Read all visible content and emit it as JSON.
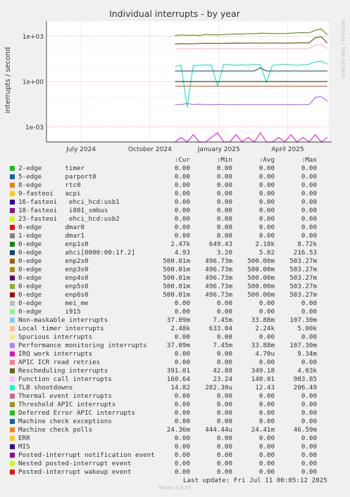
{
  "chart_data": {
    "type": "line",
    "title": "Individual interrupts - by year",
    "ylabel": "interrupts / second",
    "xlabel": "",
    "y_scale": "log",
    "ylim": [
      0.0001,
      10000
    ],
    "y_ticks": [
      "1e+03",
      "1e+00",
      "1e-03"
    ],
    "x_ticks": [
      "July 2024",
      "October 2024",
      "January 2025",
      "April 2025"
    ],
    "side_label": "RRDTOOL / TOBI OETIKER",
    "grid": true,
    "series_levels": [
      {
        "color": "#4d7f00",
        "values": [
          1100,
          1200,
          1150,
          1180,
          1100,
          1300,
          1250,
          1200,
          1300,
          1350,
          1400,
          1380,
          1500,
          1450,
          1600,
          1550,
          1500,
          1480,
          1520,
          1600,
          1650,
          1700,
          1650,
          2500,
          3000,
          1200
        ]
      },
      {
        "color": "#553300",
        "values": [
          300,
          320,
          310,
          315,
          330,
          340,
          335,
          330,
          340,
          345,
          350,
          348,
          352,
          355,
          350,
          353,
          356,
          352,
          350,
          355,
          360,
          365,
          362,
          800,
          900,
          350
        ]
      },
      {
        "color": "#ffb0d0",
        "values": [
          140,
          150,
          145,
          150,
          148,
          152,
          150,
          149,
          151,
          153,
          150,
          152,
          150,
          151,
          150,
          152,
          149,
          150,
          151,
          150,
          152,
          150,
          151,
          260,
          280,
          150
        ]
      },
      {
        "color": "#00e0c0",
        "values": [
          10,
          12,
          0.02,
          11,
          12,
          13,
          12,
          0.5,
          14,
          13,
          12,
          13,
          12,
          14,
          13,
          0.9,
          12,
          13,
          14,
          13,
          12,
          13,
          14,
          20,
          22,
          14
        ]
      },
      {
        "color": "#0f3f6f",
        "values": [
          5,
          5,
          5,
          5,
          5,
          5,
          5,
          5,
          5,
          5,
          5,
          5,
          5,
          5,
          8,
          5,
          5,
          5,
          5,
          5,
          5,
          5,
          5,
          5,
          5,
          5
        ]
      },
      {
        "color": "#111111",
        "values": [
          1,
          1,
          1,
          1,
          1,
          1,
          1,
          1,
          1,
          1,
          1,
          1,
          1,
          1,
          1,
          1,
          1,
          1,
          1,
          1,
          1,
          1,
          1,
          1,
          1,
          1
        ]
      },
      {
        "color": "#e05000",
        "values": [
          0.5,
          0.5,
          0.5,
          0.5,
          0.5,
          0.5,
          0.5,
          0.5,
          0.5,
          0.5,
          0.5,
          0.5,
          0.5,
          0.5,
          0.5,
          0.5,
          0.5,
          0.5,
          0.5,
          0.5,
          0.5,
          0.5,
          0.5,
          0.5,
          0.5,
          0.5
        ]
      },
      {
        "color": "#9b59ff",
        "values": [
          0.03,
          0.03,
          0.035,
          0.03,
          0.032,
          0.03,
          0.03,
          0.031,
          0.03,
          0.03,
          0.03,
          0.03,
          0.03,
          0.03,
          0.03,
          0.03,
          0.03,
          0.03,
          0.03,
          0.03,
          0.03,
          0.03,
          0.03,
          0.09,
          0.1,
          0.05
        ]
      },
      {
        "color": "#e000e0",
        "values": [
          0.0001,
          0.0002,
          0.0001,
          0.0003,
          0.0001,
          0.0001,
          0.0002,
          0.0004,
          0.0001,
          0.0001,
          0.0003,
          0.0001,
          0.0002,
          0.0001,
          0.0004,
          0.0001,
          0.0001,
          0.0002,
          0.0001,
          0.0003,
          0.0001,
          0.0002,
          0.0001,
          0.0003,
          0.0001,
          0.0002
        ]
      }
    ]
  },
  "legend": {
    "headers": [
      "Cur:",
      "Min:",
      "Avg:",
      "Max:"
    ],
    "rows": [
      {
        "color": "#00cc00",
        "label": "2-edge      timer",
        "cur": "0.00",
        "min": "0.00",
        "avg": "0.00",
        "max": "0.00"
      },
      {
        "color": "#0066b3",
        "label": "5-edge      parport0",
        "cur": "0.00",
        "min": "0.00",
        "avg": "0.00",
        "max": "0.00"
      },
      {
        "color": "#ff8000",
        "label": "8-edge      rtc0",
        "cur": "0.00",
        "min": "0.00",
        "avg": "0.00",
        "max": "0.00"
      },
      {
        "color": "#ffcc00",
        "label": "9-fasteoi   acpi",
        "cur": "0.00",
        "min": "0.00",
        "avg": "0.00",
        "max": "0.00"
      },
      {
        "color": "#330099",
        "label": "16-fasteoi   ehci_hcd:usb1",
        "cur": "0.00",
        "min": "0.00",
        "avg": "0.00",
        "max": "0.00"
      },
      {
        "color": "#990099",
        "label": "18-fasteoi   i801_smbus",
        "cur": "0.00",
        "min": "0.00",
        "avg": "0.00",
        "max": "0.00"
      },
      {
        "color": "#ccff00",
        "label": "23-fasteoi   ehci_hcd:usb2",
        "cur": "0.00",
        "min": "0.00",
        "avg": "0.00",
        "max": "0.00"
      },
      {
        "color": "#ff0000",
        "label": "0-edge      dmar0",
        "cur": "0.00",
        "min": "0.00",
        "avg": "0.00",
        "max": "0.00"
      },
      {
        "color": "#808080",
        "label": "1-edge      dmar1",
        "cur": "0.00",
        "min": "0.00",
        "avg": "0.00",
        "max": "0.00"
      },
      {
        "color": "#008f00",
        "label": "0-edge      enp1s0",
        "cur": "2.47k",
        "min": "649.43",
        "avg": "2.18k",
        "max": "8.72k"
      },
      {
        "color": "#00487d",
        "label": "0-edge      ahci[0000:00:1f.2]",
        "cur": "4.93",
        "min": "3.20",
        "avg": "5.02",
        "max": "216.53"
      },
      {
        "color": "#b35a00",
        "label": "0-edge      enp2s0",
        "cur": "500.01m",
        "min": "496.73m",
        "avg": "500.00m",
        "max": "503.27m"
      },
      {
        "color": "#b38f00",
        "label": "0-edge      enp3s0",
        "cur": "500.01m",
        "min": "496.73m",
        "avg": "500.00m",
        "max": "503.27m"
      },
      {
        "color": "#6b006b",
        "label": "0-edge      enp4s0",
        "cur": "500.01m",
        "min": "496.73m",
        "avg": "500.00m",
        "max": "503.27m"
      },
      {
        "color": "#8fb300",
        "label": "0-edge      enp5s0",
        "cur": "500.01m",
        "min": "496.73m",
        "avg": "500.00m",
        "max": "503.27m"
      },
      {
        "color": "#b30000",
        "label": "0-edge      enp6s0",
        "cur": "500.01m",
        "min": "496.73m",
        "avg": "500.00m",
        "max": "503.27m"
      },
      {
        "color": "#bebebe",
        "label": "0-edge      mei_me",
        "cur": "0.00",
        "min": "0.00",
        "avg": "0.00",
        "max": "0.00"
      },
      {
        "color": "#80ff80",
        "label": "0-edge      i915",
        "cur": "0.00",
        "min": "0.00",
        "avg": "0.00",
        "max": "0.00"
      },
      {
        "color": "#80c9ff",
        "label": "Non-maskable interrupts",
        "cur": "37.09m",
        "min": "7.45m",
        "avg": "33.88m",
        "max": "107.30m"
      },
      {
        "color": "#ffc080",
        "label": "Local timer interrupts",
        "cur": "2.48k",
        "min": "633.04",
        "avg": "2.24k",
        "max": "5.00k"
      },
      {
        "color": "#ffe680",
        "label": "Spurious interrupts",
        "cur": "0.00",
        "min": "0.00",
        "avg": "0.00",
        "max": "0.00"
      },
      {
        "color": "#aa80ff",
        "label": "Performance monitoring interrupts",
        "cur": "37.09m",
        "min": "7.45m",
        "avg": "33.88m",
        "max": "107.30m"
      },
      {
        "color": "#ee00cc",
        "label": "IRQ work interrupts",
        "cur": "0.00",
        "min": "0.00",
        "avg": "4.70u",
        "max": "9.34m"
      },
      {
        "color": "#ff8080",
        "label": "APIC ICR read retries",
        "cur": "0.00",
        "min": "0.00",
        "avg": "0.00",
        "max": "0.00"
      },
      {
        "color": "#666600",
        "label": "Rescheduling interrupts",
        "cur": "391.01",
        "min": "42.88",
        "avg": "349.18",
        "max": "4.03k"
      },
      {
        "color": "#ffbfff",
        "label": "Function call interrupts",
        "cur": "160.64",
        "min": "23.24",
        "avg": "140.01",
        "max": "983.85"
      },
      {
        "color": "#00ffcc",
        "label": "TLB shootdowns",
        "cur": "14.82",
        "min": "282.30u",
        "avg": "12.43",
        "max": "206.49"
      },
      {
        "color": "#cc6699",
        "label": "Thermal event interrupts",
        "cur": "0.00",
        "min": "0.00",
        "avg": "0.00",
        "max": "0.00"
      },
      {
        "color": "#999900",
        "label": "Threshold APIC interrupts",
        "cur": "0.00",
        "min": "0.00",
        "avg": "0.00",
        "max": "0.00"
      },
      {
        "color": "#00cc00",
        "label": "Deferred Error APIC interrupts",
        "cur": "0.00",
        "min": "0.00",
        "avg": "0.00",
        "max": "0.00"
      },
      {
        "color": "#0066b3",
        "label": "Machine check exceptions",
        "cur": "0.00",
        "min": "0.00",
        "avg": "0.00",
        "max": "0.00"
      },
      {
        "color": "#ff8000",
        "label": "Machine check polls",
        "cur": "24.36m",
        "min": "444.44u",
        "avg": "24.41m",
        "max": "46.59m"
      },
      {
        "color": "#ffcc00",
        "label": "ERR",
        "cur": "0.00",
        "min": "0.00",
        "avg": "0.00",
        "max": "0.00"
      },
      {
        "color": "#330099",
        "label": "MIS",
        "cur": "0.00",
        "min": "0.00",
        "avg": "0.00",
        "max": "0.00"
      },
      {
        "color": "#990099",
        "label": "Posted-interrupt notification event",
        "cur": "0.00",
        "min": "0.00",
        "avg": "0.00",
        "max": "0.00"
      },
      {
        "color": "#ccff00",
        "label": "Nested posted-interrupt event",
        "cur": "0.00",
        "min": "0.00",
        "avg": "0.00",
        "max": "0.00"
      },
      {
        "color": "#ff0000",
        "label": "Posted-interrupt wakeup event",
        "cur": "0.00",
        "min": "0.00",
        "avg": "0.00",
        "max": "0.00"
      }
    ],
    "last_update": "Last update: Fri Jul 11 00:05:12 2025"
  },
  "footer": {
    "version": "Munin 2.0.57"
  }
}
